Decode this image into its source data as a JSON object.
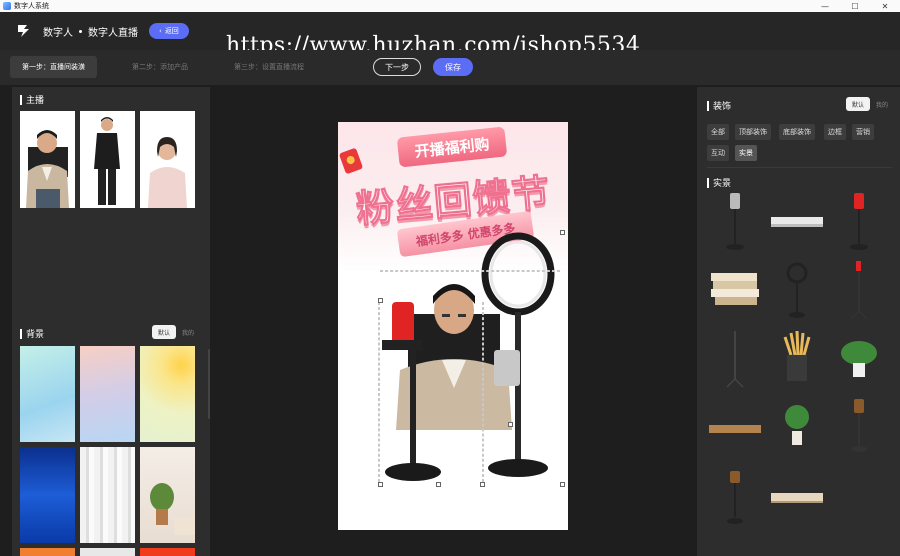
{
  "window": {
    "title": "数字人系统",
    "controls": [
      "—",
      "☐",
      "✕"
    ]
  },
  "header": {
    "breadcrumb_root": "数字人",
    "breadcrumb_current": "数字人直播",
    "back_label": "返回"
  },
  "watermark": "https://www.huzhan.com/ishop5534",
  "steps": {
    "step1": "第一步：直播间装潢",
    "step2": "第二步：添加产品",
    "step3": "第三步：设置直播流程",
    "next_label": "下一步",
    "save_label": "保存"
  },
  "left": {
    "anchor_title": "主播",
    "background_title": "背景",
    "background_tabs": [
      "默认",
      "我的"
    ]
  },
  "poster": {
    "subtitle": "开播福利购",
    "title": "粉丝回馈节",
    "ribbon": "福利多多 优惠多多"
  },
  "right": {
    "decor_title": "装饰",
    "decor_tabs": [
      "默认",
      "我的"
    ],
    "tags": [
      "全部",
      "顶部装饰",
      "底部装饰",
      "边框",
      "营销",
      "互动",
      "实景"
    ],
    "selected_tag": "实景",
    "props_title": "实景"
  },
  "colors": {
    "accent": "#5b6cf5",
    "panel": "#2d2d2d",
    "poster_pink": "#f06880"
  }
}
